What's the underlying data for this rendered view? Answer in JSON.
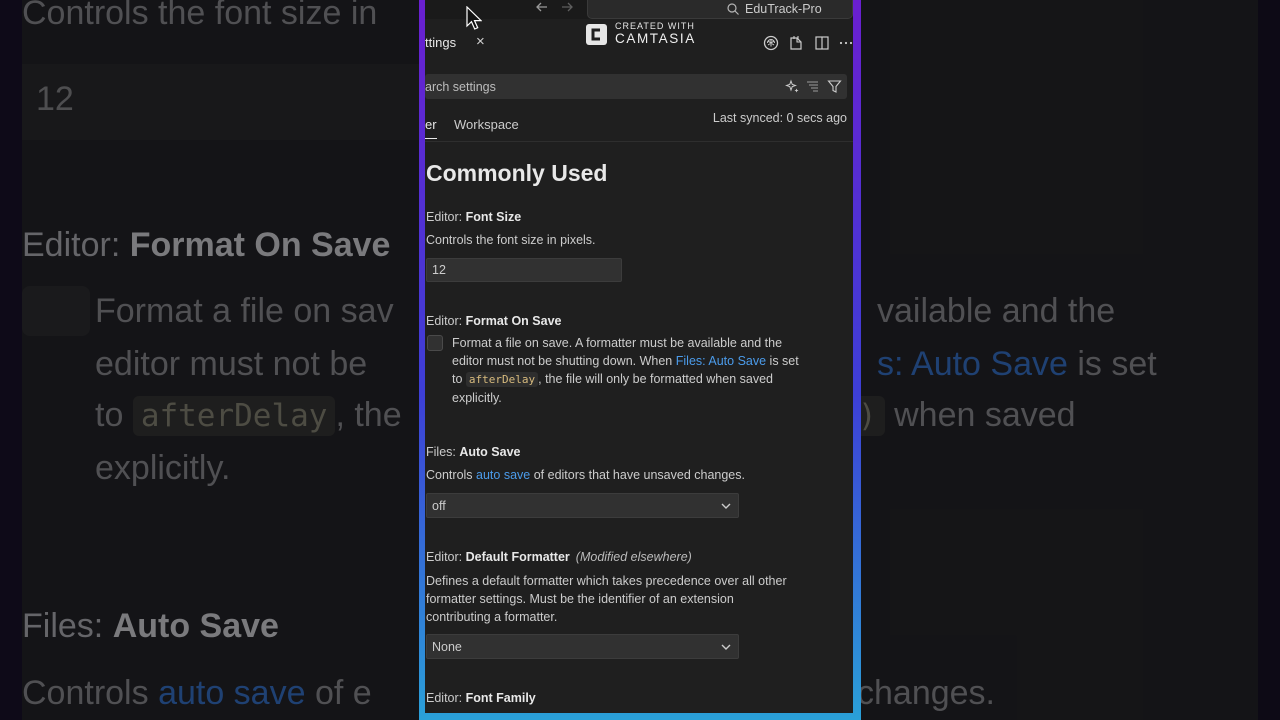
{
  "background": {
    "top_line": "Controls the font size in",
    "font_size_value": "12",
    "format_title_prefix": "Editor: ",
    "format_title_name": "Format On Save",
    "desc_line1_left": "Format a file on sav",
    "desc_line1_right": "vailable and the",
    "desc_line2_left": "editor must not be",
    "desc_line2_link": "s: Auto Save",
    "desc_line2_right": " is set",
    "desc_line3_to": "to ",
    "desc_line3_code": "afterDelay",
    "desc_line3_mid": ", the",
    "desc_line3_right": " when saved",
    "desc_line4": "explicitly.",
    "autosave_title_prefix": "Files: ",
    "autosave_title_name": "Auto Save",
    "autosave_desc_left": "Controls ",
    "autosave_desc_link": "auto save",
    "autosave_desc_mid": " of e",
    "autosave_desc_right": "changes."
  },
  "titlebar": {
    "back_icon": "arrow-left-icon",
    "forward_icon": "arrow-right-icon",
    "search_icon": "search-icon",
    "project_name": "EduTrack-Pro"
  },
  "tab": {
    "label": "ttings",
    "close": "×"
  },
  "watermark": {
    "line1": "CREATED WITH",
    "line2": "CAMTASIA"
  },
  "toolbar_icons": [
    "copilot-icon",
    "open-json-icon",
    "split-editor-icon",
    "more-icon"
  ],
  "search": {
    "placeholder": "arch settings",
    "icons": [
      "sparkle-icon",
      "clear-filter-icon",
      "filter-icon"
    ]
  },
  "scope": {
    "user": "er",
    "workspace": "Workspace",
    "sync_status": "Last synced: 0 secs ago"
  },
  "section_title": "Commonly Used",
  "settings": {
    "font_size": {
      "prefix": "Editor: ",
      "name": "Font Size",
      "description": "Controls the font size in pixels.",
      "value": "12"
    },
    "format_on_save": {
      "prefix": "Editor: ",
      "name": "Format On Save",
      "desc_1": "Format a file on save. A formatter must be available and the",
      "desc_2_pre": "editor must not be shutting down. When ",
      "desc_2_link": "Files: Auto Save",
      "desc_2_post": " is set",
      "desc_3_pre": "to ",
      "desc_3_code": "afterDelay",
      "desc_3_post": ", the file will only be formatted when saved",
      "desc_4": "explicitly.",
      "checked": false
    },
    "auto_save": {
      "prefix": "Files: ",
      "name": "Auto Save",
      "desc_pre": "Controls ",
      "desc_link": "auto save",
      "desc_post": " of editors that have unsaved changes.",
      "value": "off"
    },
    "default_formatter": {
      "prefix": "Editor: ",
      "name": "Default Formatter",
      "modified": "(Modified elsewhere)",
      "desc_1": "Defines a default formatter which takes precedence over all other",
      "desc_2": "formatter settings. Must be the identifier of an extension",
      "desc_3": "contributing a formatter.",
      "value": "None"
    },
    "font_family": {
      "prefix": "Editor: ",
      "name": "Font Family"
    }
  },
  "colors": {
    "link": "#4b9bea",
    "panel_bg": "#1f1f1f",
    "frame_top": "#6a1fd0",
    "frame_bottom": "#2aa0d8"
  }
}
